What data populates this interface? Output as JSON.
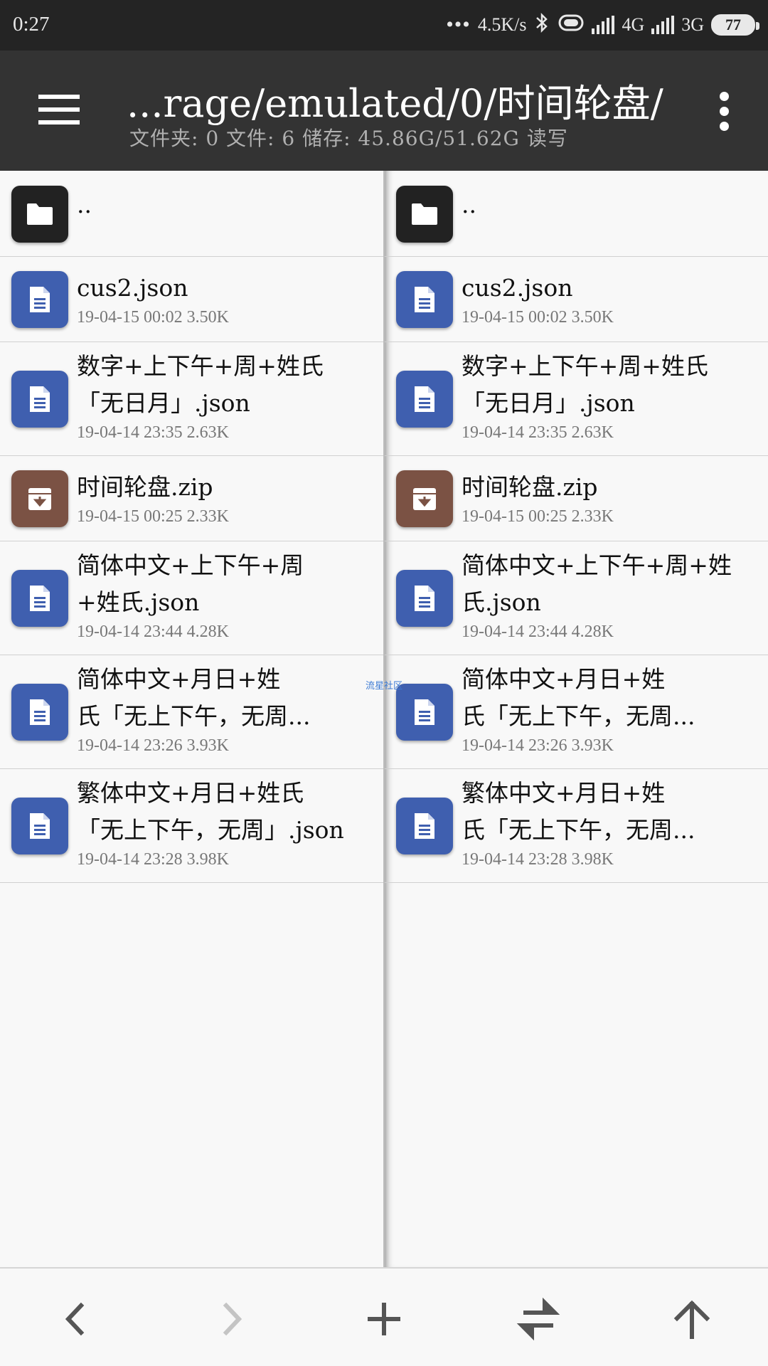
{
  "status_bar": {
    "time": "0:27",
    "net_speed": "4.5K/s",
    "net1": "4G",
    "net2": "3G",
    "battery": "77"
  },
  "toolbar": {
    "path": "...rage/emulated/0/时间轮盘/",
    "summary": "文件夹: 0  文件: 6  储存: 45.86G/51.62G  读写"
  },
  "left_pane": {
    "parent": "..",
    "files": [
      {
        "name_lines": [
          "cus2.json"
        ],
        "meta": "19-04-15 00:02  3.50K",
        "type": "doc"
      },
      {
        "name_lines": [
          "数字+上下午+周+姓氏",
          "「无日月」.json"
        ],
        "meta": "19-04-14 23:35  2.63K",
        "type": "doc"
      },
      {
        "name_lines": [
          "时间轮盘.zip"
        ],
        "meta": "19-04-15 00:25  2.33K",
        "type": "zip"
      },
      {
        "name_lines": [
          "简体中文+上下午+周",
          "+姓氏.json"
        ],
        "meta": "19-04-14 23:44  4.28K",
        "type": "doc"
      },
      {
        "name_lines": [
          "简体中文+月日+姓",
          "氏「无上下午，无周..."
        ],
        "meta": "19-04-14 23:26  3.93K",
        "type": "doc"
      },
      {
        "name_lines": [
          "繁体中文+月日+姓氏",
          "「无上下午，无周」.json"
        ],
        "meta": "19-04-14 23:28  3.98K",
        "type": "doc"
      }
    ]
  },
  "right_pane": {
    "parent": "..",
    "files": [
      {
        "name_lines": [
          "cus2.json"
        ],
        "meta": "19-04-15 00:02  3.50K",
        "type": "doc"
      },
      {
        "name_lines": [
          "数字+上下午+周+姓氏",
          "「无日月」.json"
        ],
        "meta": "19-04-14 23:35  2.63K",
        "type": "doc"
      },
      {
        "name_lines": [
          "时间轮盘.zip"
        ],
        "meta": "19-04-15 00:25  2.33K",
        "type": "zip"
      },
      {
        "name_lines": [
          "简体中文+上下午+周+姓",
          "氏.json"
        ],
        "meta": "19-04-14 23:44  4.28K",
        "type": "doc"
      },
      {
        "name_lines": [
          "简体中文+月日+姓",
          "氏「无上下午，无周..."
        ],
        "meta": "19-04-14 23:26  3.93K",
        "type": "doc"
      },
      {
        "name_lines": [
          "繁体中文+月日+姓",
          "氏「无上下午，无周..."
        ],
        "meta": "19-04-14 23:28  3.98K",
        "type": "doc"
      }
    ]
  },
  "watermark": "流星社区",
  "icons": {
    "menu": "hamburger-menu-icon",
    "more": "more-vert-icon",
    "folder": "folder-icon",
    "doc": "document-icon",
    "zip": "archive-icon",
    "back": "chevron-left-icon",
    "forward": "chevron-right-icon",
    "add": "plus-icon",
    "swap": "swap-horiz-icon",
    "up": "arrow-up-icon"
  },
  "colors": {
    "status_bar": "#242424",
    "toolbar": "#333333",
    "doc_icon": "#3f5faf",
    "zip_icon": "#7b5244",
    "folder_icon": "#222222"
  }
}
